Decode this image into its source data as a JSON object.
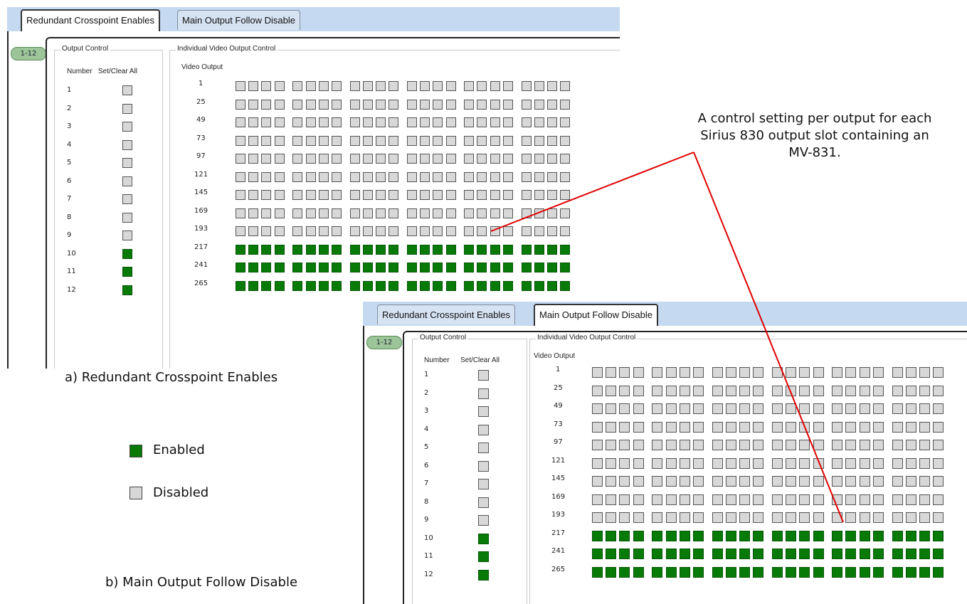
{
  "tabs": [
    {
      "label": "Redundant Crosspoint Enables"
    },
    {
      "label": "Main Output Follow Disable"
    }
  ],
  "page_pill": "1-12",
  "output_control": {
    "title": "Output Control",
    "number_header": "Number",
    "set_clear_header": "Set/Clear All",
    "rows": [
      {
        "number": "1",
        "enabled": false
      },
      {
        "number": "2",
        "enabled": false
      },
      {
        "number": "3",
        "enabled": false
      },
      {
        "number": "4",
        "enabled": false
      },
      {
        "number": "5",
        "enabled": false
      },
      {
        "number": "6",
        "enabled": false
      },
      {
        "number": "7",
        "enabled": false
      },
      {
        "number": "8",
        "enabled": false
      },
      {
        "number": "9",
        "enabled": false
      },
      {
        "number": "10",
        "enabled": true
      },
      {
        "number": "11",
        "enabled": true
      },
      {
        "number": "12",
        "enabled": true
      }
    ]
  },
  "individual_control": {
    "title": "Individual Video Output Control",
    "video_output_header": "Video Output",
    "columns_per_row": 24,
    "group_size": 4,
    "rows": [
      {
        "start": "1",
        "enabled": false
      },
      {
        "start": "25",
        "enabled": false
      },
      {
        "start": "49",
        "enabled": false
      },
      {
        "start": "73",
        "enabled": false
      },
      {
        "start": "97",
        "enabled": false
      },
      {
        "start": "121",
        "enabled": false
      },
      {
        "start": "145",
        "enabled": false
      },
      {
        "start": "169",
        "enabled": false
      },
      {
        "start": "193",
        "enabled": false
      },
      {
        "start": "217",
        "enabled": true
      },
      {
        "start": "241",
        "enabled": true
      },
      {
        "start": "265",
        "enabled": true
      }
    ]
  },
  "captions": {
    "a": "a) Redundant Crosspoint Enables",
    "b": "b) Main Output Follow Disable"
  },
  "legend": {
    "enabled_label": "Enabled",
    "disabled_label": "Disabled",
    "enabled_color": "#087a08",
    "disabled_color": "#d8d8d8"
  },
  "annotation": {
    "line1": "A control setting per output for each",
    "line2": "Sirius 830 output slot containing an",
    "line3": "MV-831.",
    "line_color": "#e00000"
  }
}
